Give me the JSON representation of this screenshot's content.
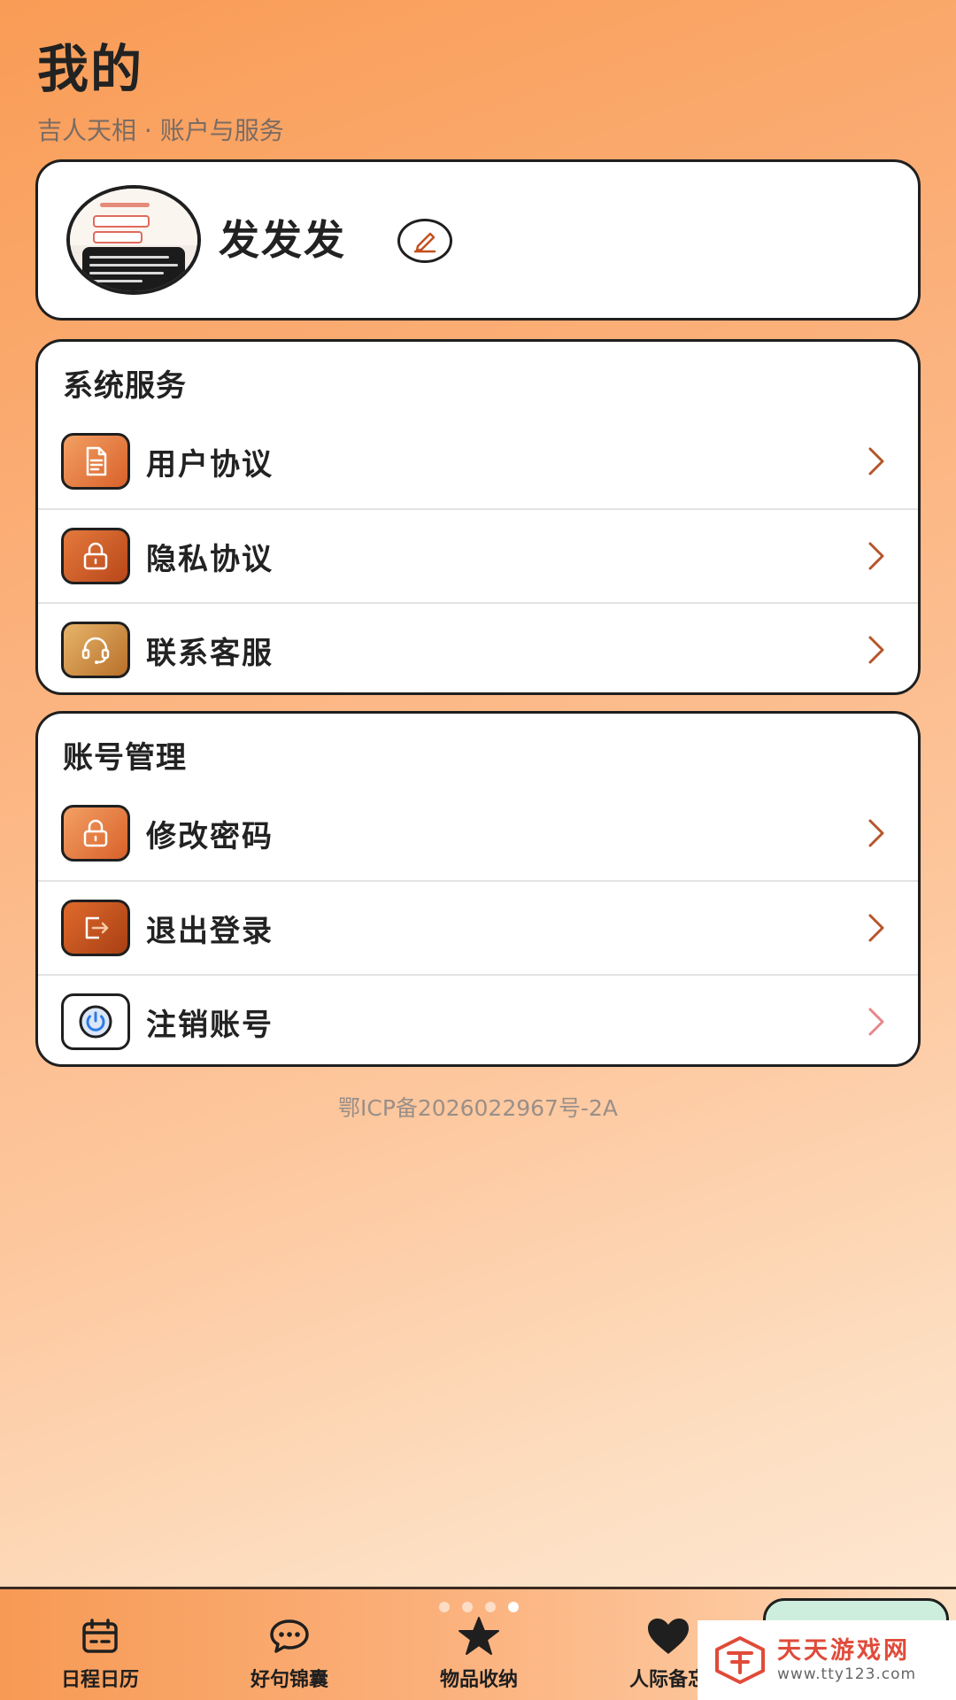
{
  "header": {
    "title": "我的",
    "subtitle": "吉人天相 · 账户与服务"
  },
  "profile": {
    "username": "发发发",
    "edit_icon": "pencil-icon"
  },
  "services": {
    "title": "系统服务",
    "items": [
      {
        "label": "用户协议",
        "icon": "document-icon"
      },
      {
        "label": "隐私协议",
        "icon": "lock-icon"
      },
      {
        "label": "联系客服",
        "icon": "headset-icon"
      }
    ]
  },
  "account": {
    "title": "账号管理",
    "items": [
      {
        "label": "修改密码",
        "icon": "lock-icon"
      },
      {
        "label": "退出登录",
        "icon": "logout-icon"
      },
      {
        "label": "注销账号",
        "icon": "power-icon"
      }
    ]
  },
  "footer": {
    "icp": "鄂ICP备2026022967号-2A"
  },
  "tabbar": {
    "tabs": [
      {
        "label": "日程日历",
        "icon": "calendar-icon"
      },
      {
        "label": "好句锦囊",
        "icon": "chat-bubble-icon"
      },
      {
        "label": "物品收纳",
        "icon": "star-icon"
      },
      {
        "label": "人际备忘",
        "icon": "heart-icon"
      }
    ],
    "page_dots": 4,
    "active_dot": 4
  },
  "watermark": {
    "title": "天天游戏网",
    "url": "www.tty123.com"
  },
  "colors": {
    "accent": "#d8612a",
    "chevron": "#b5552a",
    "chevron_light": "#e8868a",
    "background_start": "#f99c56",
    "background_end": "#fee9d6"
  }
}
